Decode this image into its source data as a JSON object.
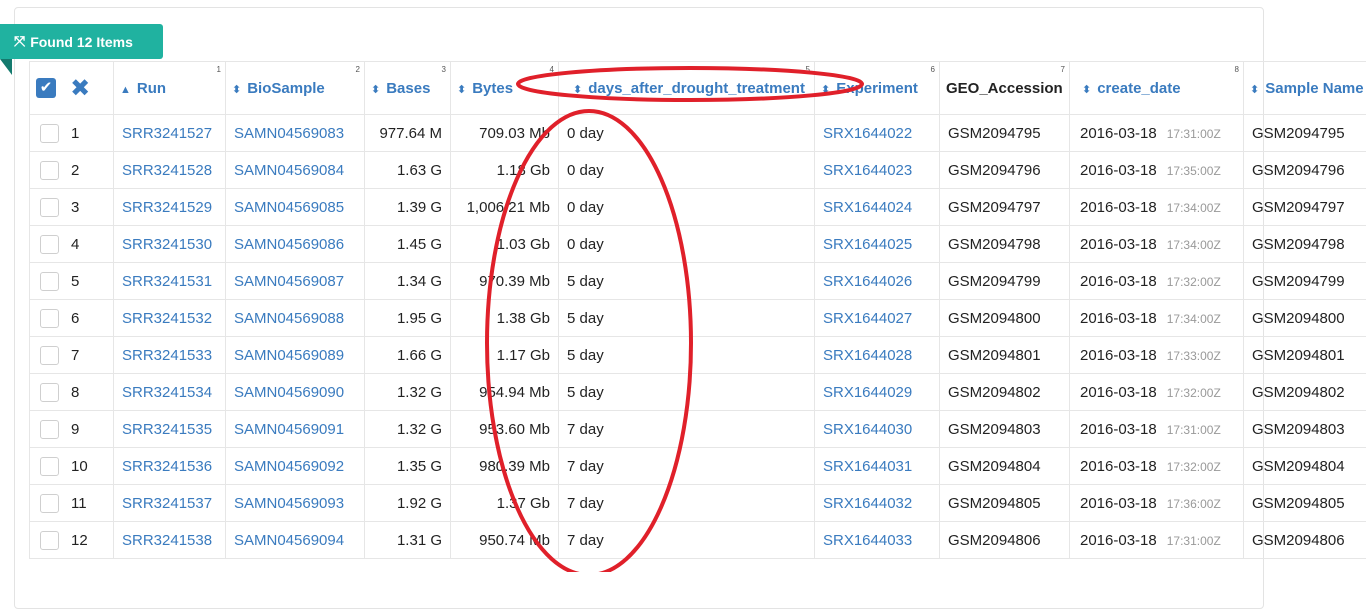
{
  "badge": {
    "text": "Found 12 Items",
    "icon": "expand-arrows-icon",
    "color": "#20b2a0"
  },
  "columns": [
    {
      "label": "",
      "num": ""
    },
    {
      "label": "Run",
      "num": "1"
    },
    {
      "label": "BioSample",
      "num": "2"
    },
    {
      "label": "Bases",
      "num": "3"
    },
    {
      "label": "Bytes",
      "num": "4"
    },
    {
      "label": "days_after_drought_treatment",
      "num": "5"
    },
    {
      "label": "Experiment",
      "num": "6"
    },
    {
      "label": "GEO_Accession",
      "num": "7"
    },
    {
      "label": "create_date",
      "num": "8"
    },
    {
      "label": "Sample Name",
      "num": ""
    }
  ],
  "rows": [
    {
      "n": "1",
      "run": "SRR3241527",
      "biosample": "SAMN04569083",
      "bases": "977.64 M",
      "bytes": "709.03 Mb",
      "days": "0 day",
      "exp": "SRX1644022",
      "geo": "GSM2094795",
      "date": "2016-03-18",
      "time": "17:31:00Z",
      "sample": "GSM2094795"
    },
    {
      "n": "2",
      "run": "SRR3241528",
      "biosample": "SAMN04569084",
      "bases": "1.63 G",
      "bytes": "1.18 Gb",
      "days": "0 day",
      "exp": "SRX1644023",
      "geo": "GSM2094796",
      "date": "2016-03-18",
      "time": "17:35:00Z",
      "sample": "GSM2094796"
    },
    {
      "n": "3",
      "run": "SRR3241529",
      "biosample": "SAMN04569085",
      "bases": "1.39 G",
      "bytes": "1,006.21 Mb",
      "days": "0 day",
      "exp": "SRX1644024",
      "geo": "GSM2094797",
      "date": "2016-03-18",
      "time": "17:34:00Z",
      "sample": "GSM2094797"
    },
    {
      "n": "4",
      "run": "SRR3241530",
      "biosample": "SAMN04569086",
      "bases": "1.45 G",
      "bytes": "1.03 Gb",
      "days": "0 day",
      "exp": "SRX1644025",
      "geo": "GSM2094798",
      "date": "2016-03-18",
      "time": "17:34:00Z",
      "sample": "GSM2094798"
    },
    {
      "n": "5",
      "run": "SRR3241531",
      "biosample": "SAMN04569087",
      "bases": "1.34 G",
      "bytes": "970.39 Mb",
      "days": "5 day",
      "exp": "SRX1644026",
      "geo": "GSM2094799",
      "date": "2016-03-18",
      "time": "17:32:00Z",
      "sample": "GSM2094799"
    },
    {
      "n": "6",
      "run": "SRR3241532",
      "biosample": "SAMN04569088",
      "bases": "1.95 G",
      "bytes": "1.38 Gb",
      "days": "5 day",
      "exp": "SRX1644027",
      "geo": "GSM2094800",
      "date": "2016-03-18",
      "time": "17:34:00Z",
      "sample": "GSM2094800"
    },
    {
      "n": "7",
      "run": "SRR3241533",
      "biosample": "SAMN04569089",
      "bases": "1.66 G",
      "bytes": "1.17 Gb",
      "days": "5 day",
      "exp": "SRX1644028",
      "geo": "GSM2094801",
      "date": "2016-03-18",
      "time": "17:33:00Z",
      "sample": "GSM2094801"
    },
    {
      "n": "8",
      "run": "SRR3241534",
      "biosample": "SAMN04569090",
      "bases": "1.32 G",
      "bytes": "954.94 Mb",
      "days": "5 day",
      "exp": "SRX1644029",
      "geo": "GSM2094802",
      "date": "2016-03-18",
      "time": "17:32:00Z",
      "sample": "GSM2094802"
    },
    {
      "n": "9",
      "run": "SRR3241535",
      "biosample": "SAMN04569091",
      "bases": "1.32 G",
      "bytes": "953.60 Mb",
      "days": "7 day",
      "exp": "SRX1644030",
      "geo": "GSM2094803",
      "date": "2016-03-18",
      "time": "17:31:00Z",
      "sample": "GSM2094803"
    },
    {
      "n": "10",
      "run": "SRR3241536",
      "biosample": "SAMN04569092",
      "bases": "1.35 G",
      "bytes": "980.39 Mb",
      "days": "7 day",
      "exp": "SRX1644031",
      "geo": "GSM2094804",
      "date": "2016-03-18",
      "time": "17:32:00Z",
      "sample": "GSM2094804"
    },
    {
      "n": "11",
      "run": "SRR3241537",
      "biosample": "SAMN04569093",
      "bases": "1.92 G",
      "bytes": "1.37 Gb",
      "days": "7 day",
      "exp": "SRX1644032",
      "geo": "GSM2094805",
      "date": "2016-03-18",
      "time": "17:36:00Z",
      "sample": "GSM2094805"
    },
    {
      "n": "12",
      "run": "SRR3241538",
      "biosample": "SAMN04569094",
      "bases": "1.31 G",
      "bytes": "950.74 Mb",
      "days": "7 day",
      "exp": "SRX1644033",
      "geo": "GSM2094806",
      "date": "2016-03-18",
      "time": "17:31:00Z",
      "sample": "GSM2094806"
    }
  ],
  "colors": {
    "link": "#3a7bbf",
    "annotation": "#e0202a"
  }
}
